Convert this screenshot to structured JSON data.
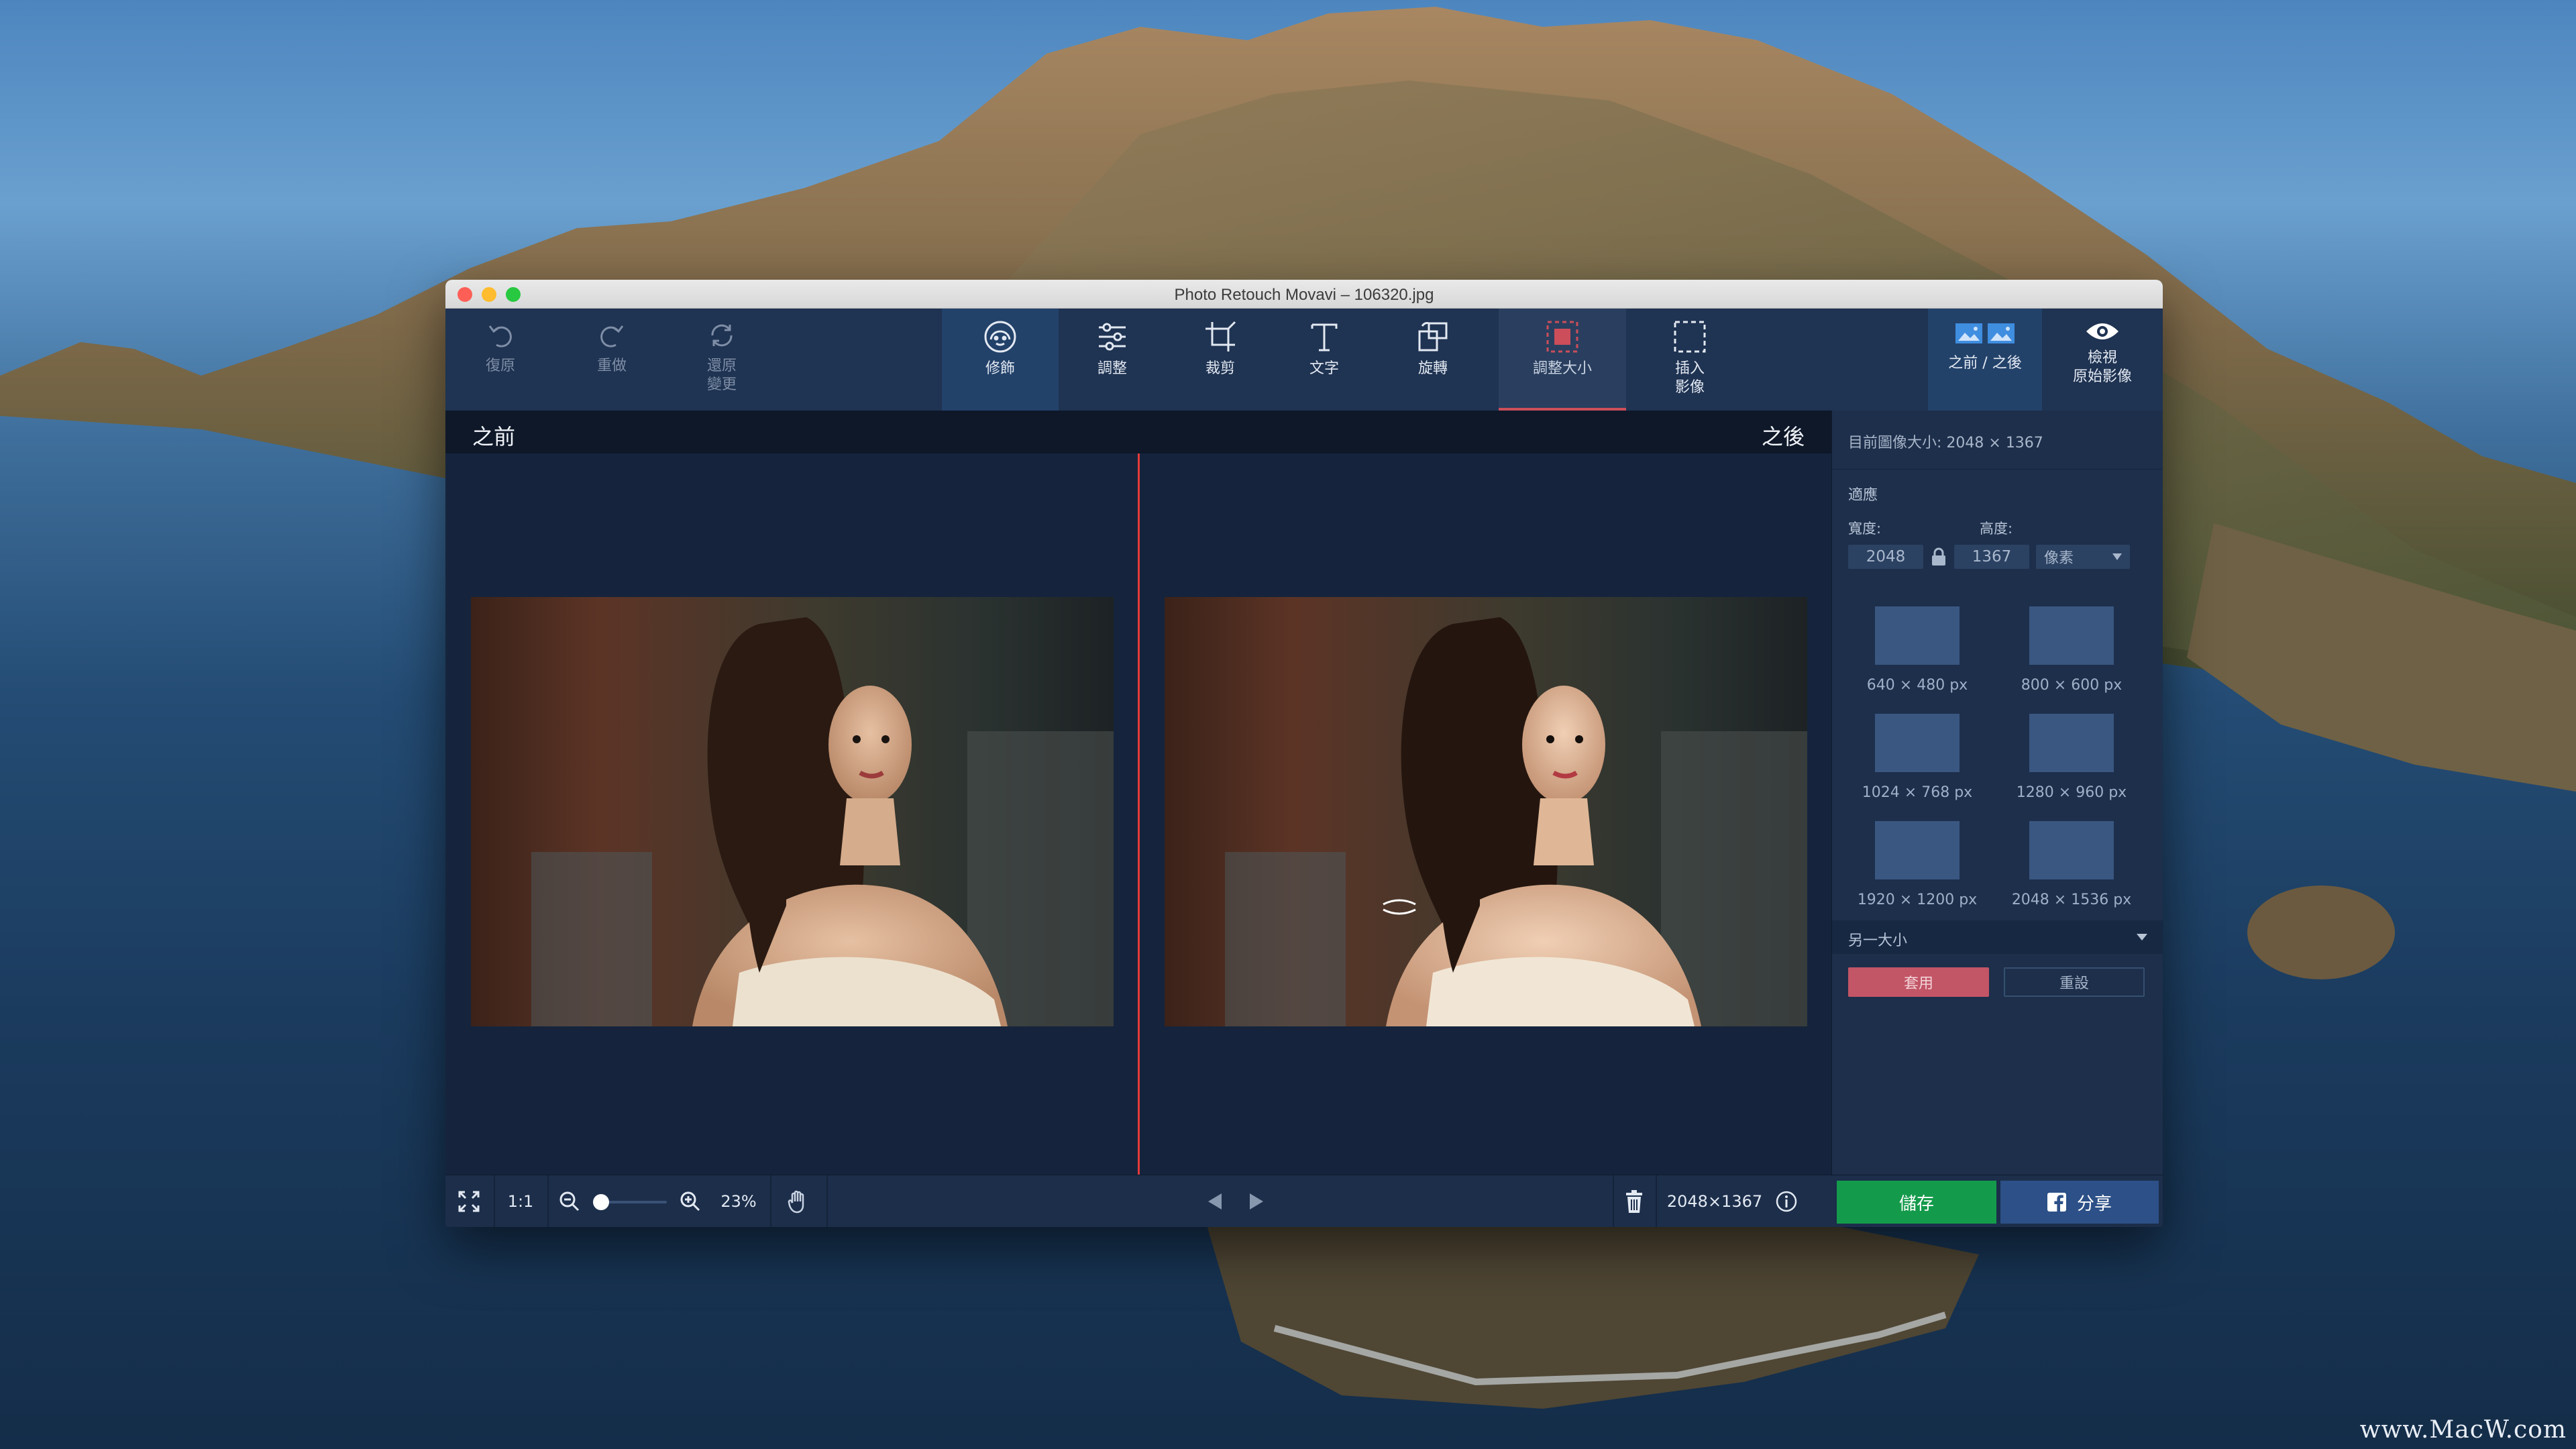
{
  "window": {
    "title": "Photo Retouch Movavi – 106320.jpg"
  },
  "toolbar": {
    "undo": "復原",
    "redo": "重做",
    "revert": "還原\n變更",
    "retouch": "修飾",
    "adjust": "調整",
    "crop": "裁剪",
    "text": "文字",
    "rotate": "旋轉",
    "resize": "調整大小",
    "insert": "插入\n影像",
    "before_after": "之前 / 之後",
    "view_original": "檢視\n原始影像"
  },
  "compare": {
    "before": "之前",
    "after": "之後"
  },
  "panel": {
    "current_size": "目前圖像大小: 2048 × 1367",
    "fit_label": "適應",
    "width_label": "寬度:",
    "height_label": "高度:",
    "width_value": "2048",
    "height_value": "1367",
    "unit": "像素",
    "presets": [
      "640 × 480 px",
      "800 × 600 px",
      "1024 × 768 px",
      "1280 × 960 px",
      "1920 × 1200 px",
      "2048 × 1536 px"
    ],
    "other_size": "另一大小",
    "apply": "套用",
    "reset": "重設"
  },
  "bottombar": {
    "one_to_one": "1:1",
    "zoom": "23%",
    "dimensions": "2048×1367",
    "save": "儲存",
    "share": "分享"
  },
  "colors": {
    "accent_red": "#cc4e5a",
    "divider": "#e33a3a",
    "save_green": "#149a4b",
    "share_blue": "#2c5087"
  },
  "watermark": "www.MacW.com"
}
